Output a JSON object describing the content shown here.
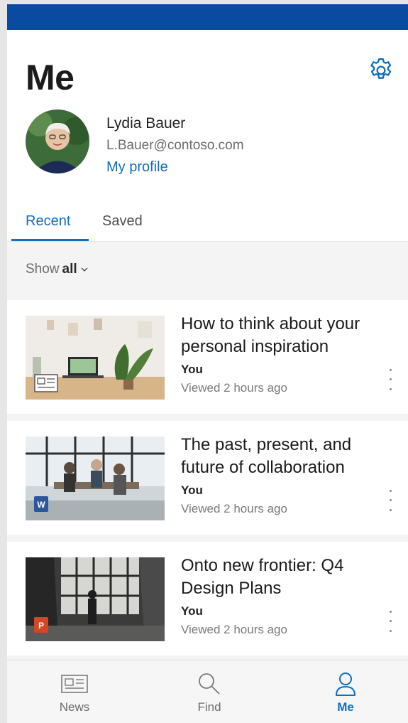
{
  "header": {
    "title": "Me",
    "user": {
      "name": "Lydia Bauer",
      "email": "L.Bauer@contoso.com",
      "profile_link": "My profile"
    }
  },
  "tabs": [
    {
      "label": "Recent",
      "active": true
    },
    {
      "label": "Saved",
      "active": false
    }
  ],
  "filter": {
    "prefix": "Show",
    "value": "all"
  },
  "cards": [
    {
      "title": "How to think about your personal inspiration",
      "author": "You",
      "time": "Viewed 2 hours ago",
      "file_icon": "news-icon"
    },
    {
      "title": "The past, present, and future of collaboration",
      "author": "You",
      "time": "Viewed 2 hours ago",
      "file_icon": "word-icon"
    },
    {
      "title": "Onto new frontier: Q4 Design Plans",
      "author": "You",
      "time": "Viewed 2 hours ago",
      "file_icon": "powerpoint-icon"
    }
  ],
  "bottom_nav": [
    {
      "label": "News",
      "icon": "news-icon",
      "active": false
    },
    {
      "label": "Find",
      "icon": "search-icon",
      "active": false
    },
    {
      "label": "Me",
      "icon": "person-icon",
      "active": true
    }
  ],
  "colors": {
    "accent": "#106ebe",
    "topbar": "#0a4aa0",
    "word": "#2b579a",
    "powerpoint": "#d24726"
  }
}
